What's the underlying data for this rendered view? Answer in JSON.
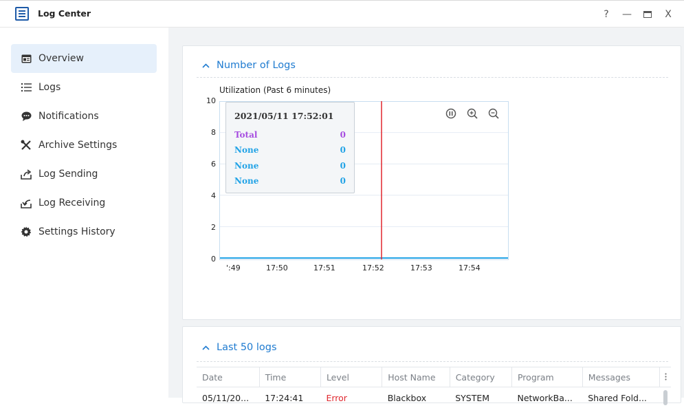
{
  "window": {
    "title": "Log Center",
    "buttons": {
      "help": "?",
      "minimize": "—",
      "maximize": "▭",
      "close": "X"
    }
  },
  "sidebar": {
    "items": [
      {
        "label": "Overview",
        "icon": "overview-icon",
        "active": true
      },
      {
        "label": "Logs",
        "icon": "list-icon"
      },
      {
        "label": "Notifications",
        "icon": "chat-bubble-icon"
      },
      {
        "label": "Archive Settings",
        "icon": "tools-icon"
      },
      {
        "label": "Log Sending",
        "icon": "share-out-icon"
      },
      {
        "label": "Log Receiving",
        "icon": "share-in-icon"
      },
      {
        "label": "Settings History",
        "icon": "gear-icon"
      }
    ]
  },
  "number_of_logs": {
    "heading": "Number of Logs",
    "tooltip": {
      "time": "2021/05/11 17:52:01",
      "rows": [
        {
          "name": "Total",
          "value": "0",
          "color": "#a64ce0"
        },
        {
          "name": "None",
          "value": "0",
          "color": "#22a3e6"
        },
        {
          "name": "None",
          "value": "0",
          "color": "#22a3e6"
        },
        {
          "name": "None",
          "value": "0",
          "color": "#22a3e6"
        }
      ]
    },
    "controls": {
      "pause_icon": "pause-circle-icon",
      "zoom_in_icon": "zoom-in-icon",
      "zoom_out_icon": "zoom-out-icon"
    }
  },
  "chart_data": {
    "type": "line",
    "title": "Utilization (Past 6 minutes)",
    "xlabel": "",
    "ylabel": "",
    "ylim": [
      0,
      10
    ],
    "y_ticks": [
      "10",
      "8",
      "6",
      "4",
      "2",
      "0"
    ],
    "x_ticks": [
      "':49",
      "17:50",
      "17:51",
      "17:52",
      "17:53",
      "17:54"
    ],
    "series": [
      {
        "name": "Total",
        "values": [
          0,
          0,
          0,
          0,
          0,
          0
        ],
        "color": "#a64ce0"
      },
      {
        "name": "None",
        "values": [
          0,
          0,
          0,
          0,
          0,
          0
        ],
        "color": "#22a3e6"
      }
    ],
    "cursor_x": "17:52",
    "cursor_color": "#e0262d",
    "grid": true
  },
  "last_logs": {
    "heading": "Last 50 logs",
    "columns": [
      "Date",
      "Time",
      "Level",
      "Host Name",
      "Category",
      "Program",
      "Messages"
    ],
    "rows": [
      {
        "date": "05/11/20...",
        "time": "17:24:41",
        "level": "Error",
        "host": "Blackbox",
        "category": "SYSTEM",
        "program": "NetworkBa...",
        "message": "Shared Fold..."
      }
    ],
    "level_error_color": "#e0262d"
  }
}
